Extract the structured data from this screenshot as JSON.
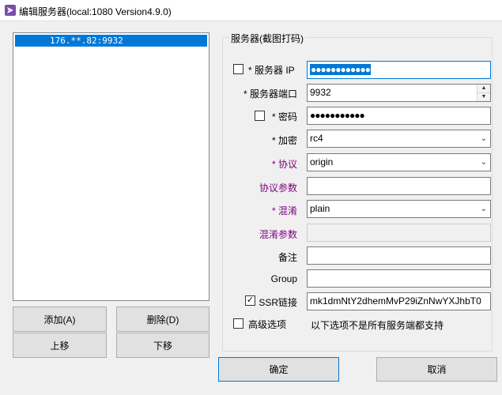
{
  "window": {
    "title": "编辑服务器(local:1080 Version4.9.0)"
  },
  "server_list": {
    "items": [
      "176.**.82:9932"
    ]
  },
  "list_buttons": {
    "add": "添加(A)",
    "delete": "删除(D)",
    "move_up": "上移",
    "move_down": "下移"
  },
  "server_group": {
    "title": "服务器(截图打码)"
  },
  "form": {
    "server_ip_label": "* 服务器 IP",
    "server_ip_value": "●●●●●●●●●●●●",
    "server_port_label": "* 服务器端口",
    "server_port_value": "9932",
    "password_label": "* 密码",
    "password_value": "●●●●●●●●●●●",
    "encryption_label": "* 加密",
    "encryption_value": "rc4",
    "protocol_label": "* 协议",
    "protocol_value": "origin",
    "protocol_param_label": "协议参数",
    "protocol_param_value": "",
    "obfs_label": "* 混淆",
    "obfs_value": "plain",
    "obfs_param_label": "混淆参数",
    "obfs_param_value": "",
    "remarks_label": "备注",
    "remarks_value": "",
    "group_label": "Group",
    "group_value": "",
    "ssr_link_label": "SSR链接",
    "ssr_link_value": "mk1dmNtY2dhemMvP29iZnNwYXJhbT0",
    "advanced_label": "高级选项",
    "advanced_note": "以下选项不是所有服务端都支持"
  },
  "dialog_buttons": {
    "ok": "确定",
    "cancel": "取消"
  },
  "colors": {
    "selection": "#0078d7",
    "optional_label": "#800080"
  }
}
